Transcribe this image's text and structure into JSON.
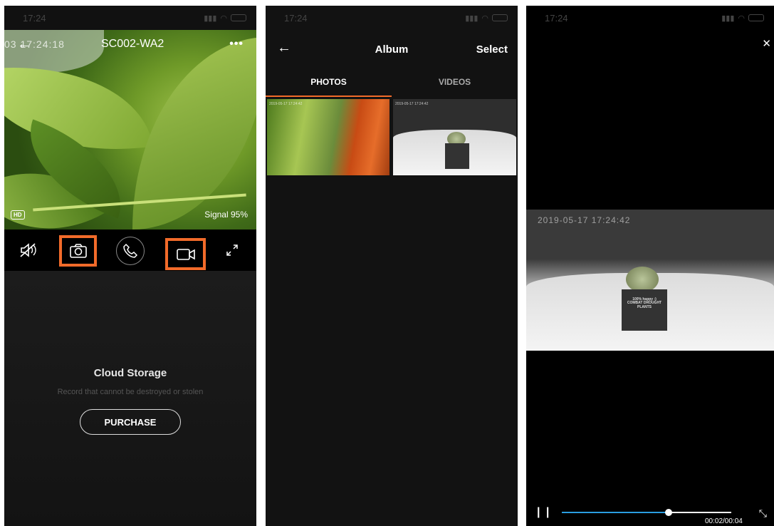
{
  "status_bar": {
    "time": "17:24"
  },
  "live": {
    "title": "SC002-WA2",
    "timestamp_overlay": "03 17:24:18",
    "hd_badge": "HD",
    "signal": "Signal 95%",
    "icons": [
      "mute-icon",
      "snapshot-icon",
      "call-icon",
      "record-icon",
      "fullscreen-icon"
    ]
  },
  "cloud": {
    "title": "Cloud Storage",
    "subtitle": "Record that cannot be destroyed or stolen",
    "purchase_label": "PURCHASE"
  },
  "album": {
    "title": "Album",
    "select_label": "Select",
    "tabs": [
      {
        "label": "PHOTOS",
        "active": true
      },
      {
        "label": "VIDEOS",
        "active": false
      }
    ],
    "thumb_timestamps": [
      "2019-05-17 17:24:42",
      "2019-05-17 17:24:42"
    ]
  },
  "player": {
    "video_timestamp": "2019-05-17 17:24:42",
    "time": "00:02/00:04",
    "progress_fraction": 0.63,
    "pot_text": "100% happy :) COMBAT DROUGHT PLANTS"
  },
  "colors": {
    "accent": "#f26b2a",
    "seek": "#2a9de0"
  }
}
